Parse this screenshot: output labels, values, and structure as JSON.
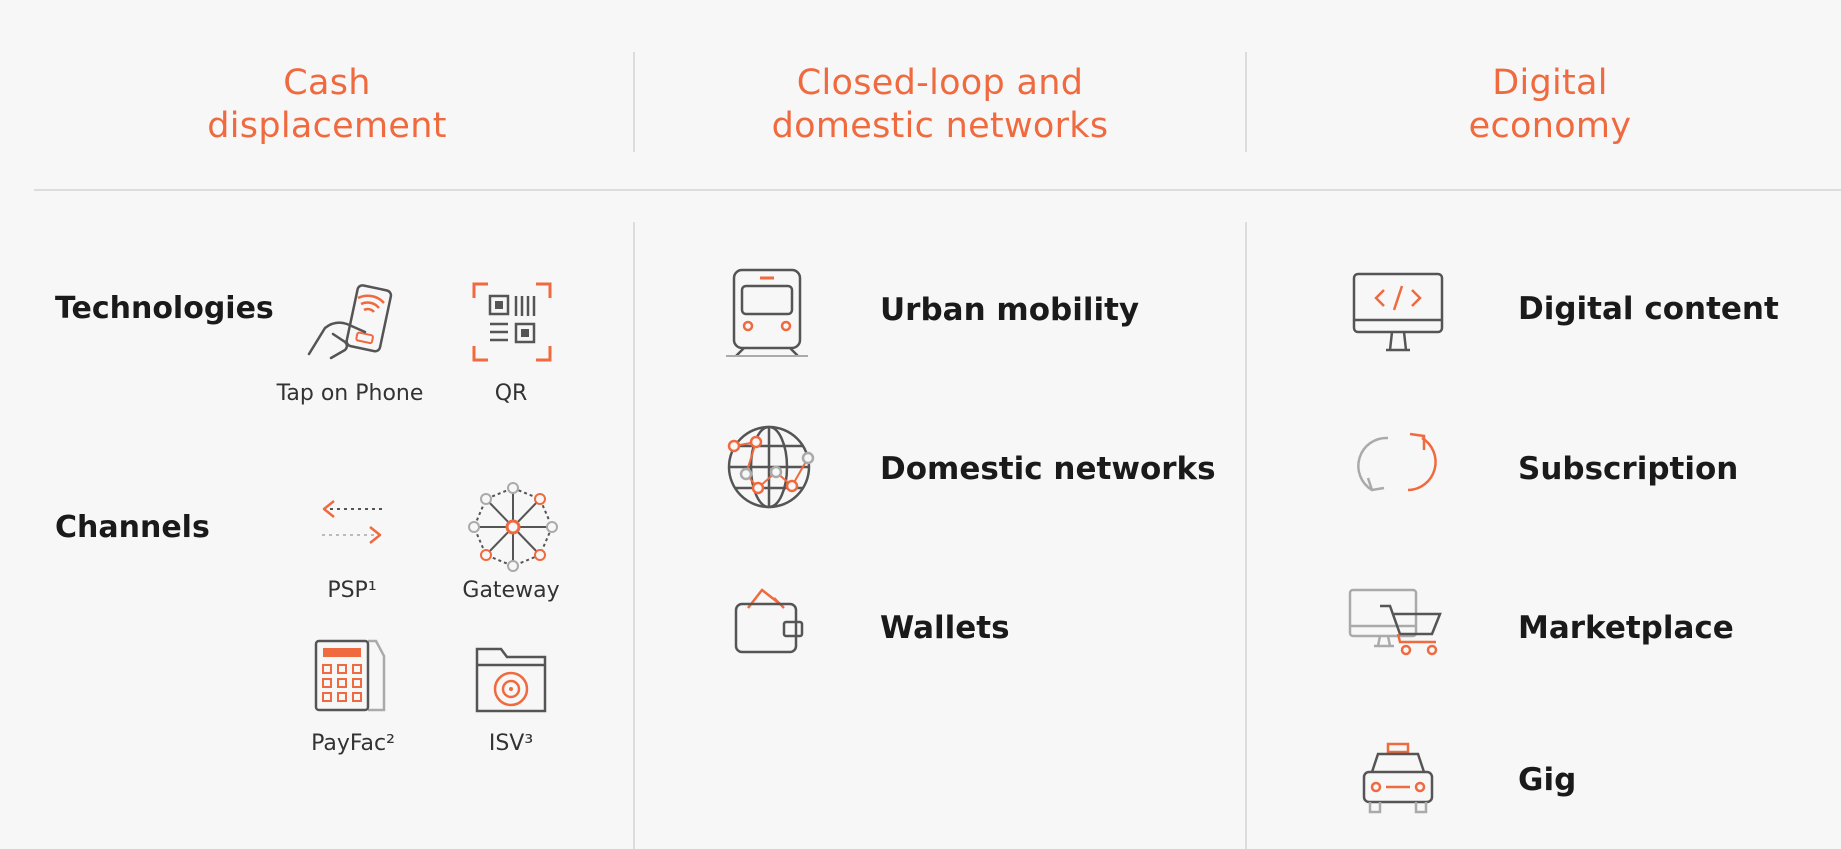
{
  "columns": [
    {
      "title_line1": "Cash",
      "title_line2": "displacement"
    },
    {
      "title_line1": "Closed-loop and",
      "title_line2": "domestic networks"
    },
    {
      "title_line1": "Digital",
      "title_line2": "economy"
    }
  ],
  "cash": {
    "technologies_label": "Technologies",
    "channels_label": "Channels",
    "technologies": [
      {
        "label": "Tap on Phone",
        "icon": "tap-on-phone-icon"
      },
      {
        "label": "QR",
        "icon": "qr-code-icon"
      }
    ],
    "channels": [
      {
        "label": "PSP¹",
        "icon": "psp-arrows-icon"
      },
      {
        "label": "Gateway",
        "icon": "gateway-network-icon"
      },
      {
        "label": "PayFac²",
        "icon": "payfac-calculator-icon"
      },
      {
        "label": "ISV³",
        "icon": "isv-folder-icon"
      }
    ]
  },
  "closed_loop": {
    "items": [
      {
        "label": "Urban mobility",
        "icon": "train-icon"
      },
      {
        "label": "Domestic networks",
        "icon": "globe-network-icon"
      },
      {
        "label": "Wallets",
        "icon": "wallet-icon"
      }
    ]
  },
  "digital": {
    "items": [
      {
        "label": "Digital content",
        "icon": "monitor-code-icon"
      },
      {
        "label": "Subscription",
        "icon": "refresh-cycle-icon"
      },
      {
        "label": "Marketplace",
        "icon": "marketplace-cart-icon"
      },
      {
        "label": "Gig",
        "icon": "taxi-icon"
      }
    ]
  },
  "colors": {
    "accent": "#f06a3f",
    "line": "#dcdcdc",
    "icon_gray": "#555555",
    "background": "#f7f7f7"
  }
}
